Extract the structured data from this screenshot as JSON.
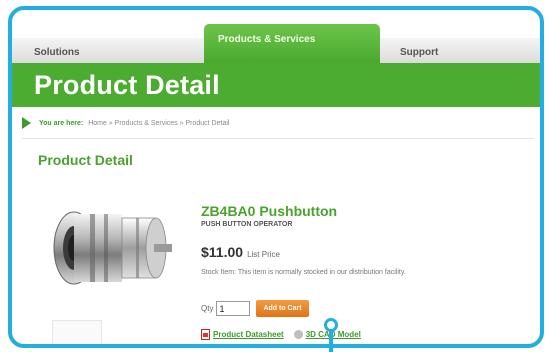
{
  "nav": {
    "tabs": [
      {
        "label": "Solutions"
      },
      {
        "label": "Products & Services",
        "active": true
      },
      {
        "label": "Support"
      }
    ]
  },
  "banner": {
    "title": "Product Detail"
  },
  "breadcrumb": {
    "label": "You are here:",
    "path": "Home »  Products & Services »  Product Detail"
  },
  "section": {
    "title": "Product Detail"
  },
  "product": {
    "name": "ZB4BA0 Pushbutton",
    "subtitle": "PUSH BUTTON OPERATOR",
    "price": "$11.00",
    "price_label": "List Price",
    "stock_note": "Stock Item: This item is normally stocked in our distribution facility.",
    "qty_label": "Qty",
    "qty_value": "1",
    "add_to_cart_label": "Add to Cart",
    "datasheet_label": "Product Datasheet",
    "cad_label": "3D CAD Model"
  },
  "colors": {
    "frame": "#22aee0",
    "brand_green": "#4cab31",
    "button_orange": "#e98a2c"
  },
  "icons": [
    "pdf-icon",
    "cad-model-icon",
    "breadcrumb-arrow-icon",
    "callout-pointer-icon"
  ]
}
